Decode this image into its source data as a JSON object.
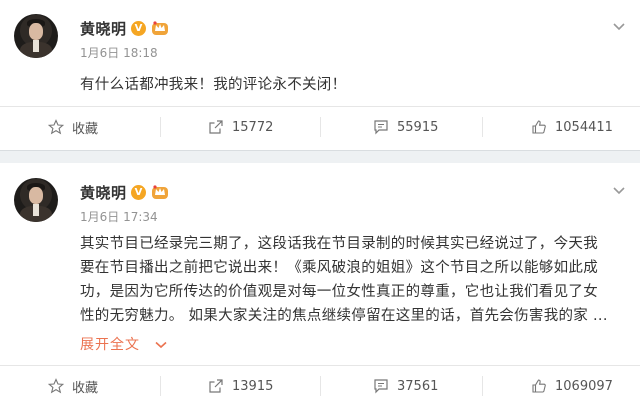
{
  "posts": [
    {
      "author": "黄晓明",
      "verified_badge": "V",
      "vip_icon": "crown-icon",
      "time": "1月6日 18:18",
      "text_lines": [
        "有什么话都冲我来！我的评论永不关闭！"
      ],
      "expand_label": "",
      "actions": {
        "favorite_label": "收藏",
        "repost_count": "15772",
        "comment_count": "55915",
        "like_count": "1054411"
      }
    },
    {
      "author": "黄晓明",
      "verified_badge": "V",
      "vip_icon": "crown-icon",
      "time": "1月6日 17:34",
      "text_lines": [
        "其实节目已经录完三期了，这段话我在节目录制的时候其实已经说过了，今天我",
        "要在节目播出之前把它说出来！《乘风破浪的姐姐》这个节目之所以能够如此成",
        "功，是因为它所传达的价值观是对每一位女性真正的尊重，它也让我们看见了女",
        "性的无穷魅力。 如果大家关注的焦点继续停留在这里的话，首先会伤害我的家 ..."
      ],
      "expand_label": "展开全文",
      "actions": {
        "favorite_label": "收藏",
        "repost_count": "13915",
        "comment_count": "37561",
        "like_count": "1069097"
      }
    }
  ],
  "colors": {
    "accent": "#eb7350",
    "verified": "#f5a623",
    "muted": "#939393",
    "separator": "#eef1f3"
  }
}
